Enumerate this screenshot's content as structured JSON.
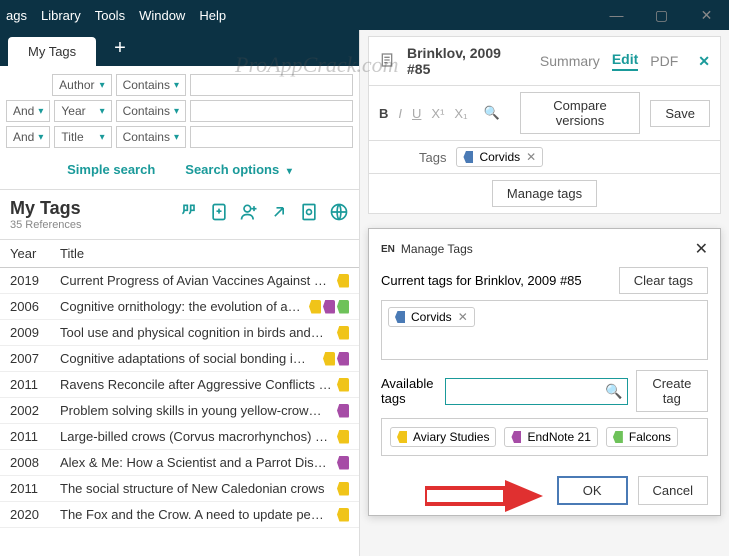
{
  "menu": {
    "items": [
      "ags",
      "Library",
      "Tools",
      "Window",
      "Help"
    ]
  },
  "tabs": {
    "active": "My Tags"
  },
  "search": {
    "rows": [
      {
        "op": "",
        "field": "Author",
        "rel": "Contains"
      },
      {
        "op": "And",
        "field": "Year",
        "rel": "Contains"
      },
      {
        "op": "And",
        "field": "Title",
        "rel": "Contains"
      }
    ],
    "simple": "Simple search",
    "options": "Search options"
  },
  "group": {
    "title": "My Tags",
    "count": "35 References"
  },
  "columns": {
    "year": "Year",
    "title": "Title"
  },
  "refs": [
    {
      "year": "2019",
      "title": "Current Progress of Avian Vaccines Against …",
      "tags": [
        "#f0c419"
      ]
    },
    {
      "year": "2006",
      "title": "Cognitive ornithology: the evolution of a…",
      "tags": [
        "#f0c419",
        "#a64ca6",
        "#6ec25a"
      ]
    },
    {
      "year": "2009",
      "title": "Tool use and physical cognition in birds and…",
      "tags": [
        "#f0c419"
      ]
    },
    {
      "year": "2007",
      "title": "Cognitive adaptations of social bonding i…",
      "tags": [
        "#f0c419",
        "#a64ca6"
      ]
    },
    {
      "year": "2011",
      "title": "Ravens Reconcile after Aggressive Conflicts …",
      "tags": [
        "#f0c419"
      ]
    },
    {
      "year": "2002",
      "title": "Problem solving skills in young yellow-crow…",
      "tags": [
        "#a64ca6"
      ]
    },
    {
      "year": "2011",
      "title": "Large-billed crows (Corvus macrorhynchos) …",
      "tags": [
        "#f0c419"
      ]
    },
    {
      "year": "2008",
      "title": "Alex & Me: How a Scientist and a Parrot Dis…",
      "tags": [
        "#a64ca6"
      ]
    },
    {
      "year": "2011",
      "title": "The social structure of New Caledonian crows",
      "tags": [
        "#f0c419"
      ]
    },
    {
      "year": "2020",
      "title": "The Fox and the Crow. A need to update pe…",
      "tags": [
        "#f0c419"
      ]
    }
  ],
  "ref": {
    "label": "Brinklov, 2009 #85",
    "tabs": {
      "summary": "Summary",
      "edit": "Edit",
      "pdf": "PDF"
    },
    "compare": "Compare versions",
    "save": "Save",
    "tags_label": "Tags",
    "tag": {
      "name": "Corvids",
      "color": "#4a7ab5"
    },
    "manage": "Manage tags"
  },
  "dialog": {
    "brand": "EN",
    "title": "Manage Tags",
    "current_label": "Current tags for Brinklov, 2009 #85",
    "clear": "Clear tags",
    "current_tags": [
      {
        "name": "Corvids",
        "color": "#4a7ab5"
      }
    ],
    "avail_label": "Available tags",
    "create": "Create tag",
    "avail_tags": [
      {
        "name": "Aviary Studies",
        "color": "#f0c419"
      },
      {
        "name": "EndNote 21",
        "color": "#a64ca6"
      },
      {
        "name": "Falcons",
        "color": "#6ec25a"
      }
    ],
    "ok": "OK",
    "cancel": "Cancel"
  },
  "watermark": "ProAppCrack.com"
}
